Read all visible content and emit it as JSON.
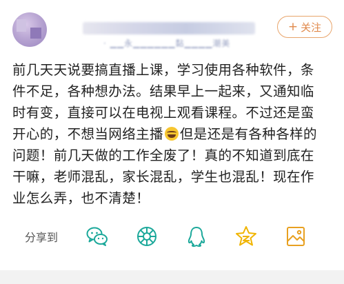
{
  "header": {
    "username_visible": "· ▁▁永▁▁▁▁▁▁黏▁▁▁▁潮美",
    "follow_label": "关注",
    "follow_plus": "+"
  },
  "post": {
    "lines": [
      "前几天天说要搞直播上课，学习使用各种软件，条",
      "件不足，各种想办法。结果早上一起来，又通知临",
      "时有变，直接可以在电视上观看课程。不过还是蛮"
    ],
    "line4_a": "开心的，不想当网络主播",
    "line4_b": "但是还是有各种各样的",
    "lines_after": [
      "问题！前几天做的工作全废了！真的不知道到底在",
      "干嘛，老师混乱，家长混乱，学生也混乱！现在作",
      "业怎么弄，也不清楚！"
    ]
  },
  "share": {
    "label": "分享到",
    "targets": [
      "wechat-icon",
      "moments-icon",
      "qq-icon",
      "qzone-icon",
      "save-image-icon"
    ]
  },
  "colors": {
    "accent": "#e0894b",
    "teal": "#1ba89a",
    "star": "#f0b400",
    "image": "#e8a020"
  }
}
